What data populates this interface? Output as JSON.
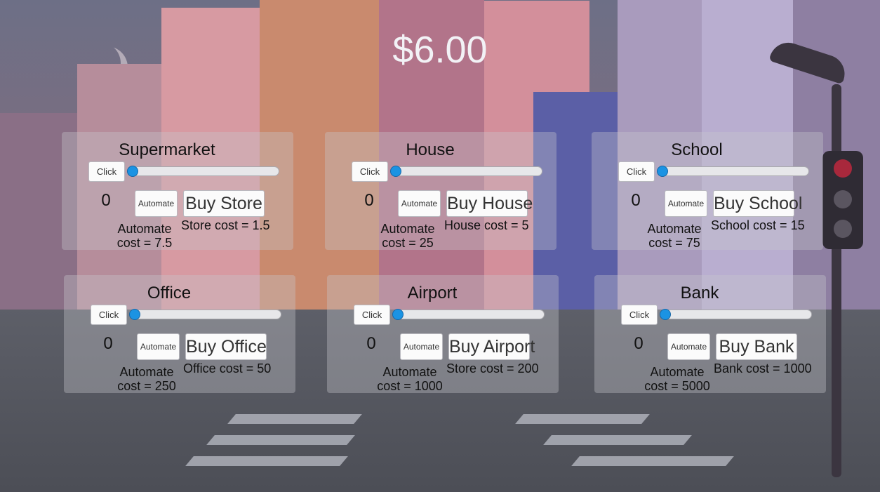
{
  "money": "$6.00",
  "automate_label": "Automate",
  "click_label": "Click",
  "panels": [
    {
      "title": "Supermarket",
      "count": "0",
      "buy_label": "Buy Store",
      "buy_cost": "Store cost = 1.5",
      "automate_cost_line1": "Automate",
      "automate_cost_line2": "cost = 7.5",
      "progress": 0
    },
    {
      "title": "House",
      "count": "0",
      "buy_label": "Buy House",
      "buy_cost": "House cost = 5",
      "automate_cost_line1": "Automate",
      "automate_cost_line2": "cost = 25",
      "progress": 0
    },
    {
      "title": "School",
      "count": "0",
      "buy_label": "Buy School",
      "buy_cost": "School cost = 15",
      "automate_cost_line1": "Automate",
      "automate_cost_line2": "cost = 75",
      "progress": 0
    },
    {
      "title": "Office",
      "count": "0",
      "buy_label": "Buy Office",
      "buy_cost": "Office cost = 50",
      "automate_cost_line1": "Automate",
      "automate_cost_line2": "cost = 250",
      "progress": 0
    },
    {
      "title": "Airport",
      "count": "0",
      "buy_label": "Buy Airport",
      "buy_cost": "Store cost = 200",
      "automate_cost_line1": "Automate",
      "automate_cost_line2": "cost = 1000",
      "progress": 0
    },
    {
      "title": "Bank",
      "count": "0",
      "buy_label": "Buy Bank",
      "buy_cost": "Bank cost = 1000",
      "automate_cost_line1": "Automate",
      "automate_cost_line2": "cost = 5000",
      "progress": 0
    }
  ],
  "colors": {
    "slider_thumb": "#1b93e3",
    "money_text": "#f2f2f6"
  }
}
